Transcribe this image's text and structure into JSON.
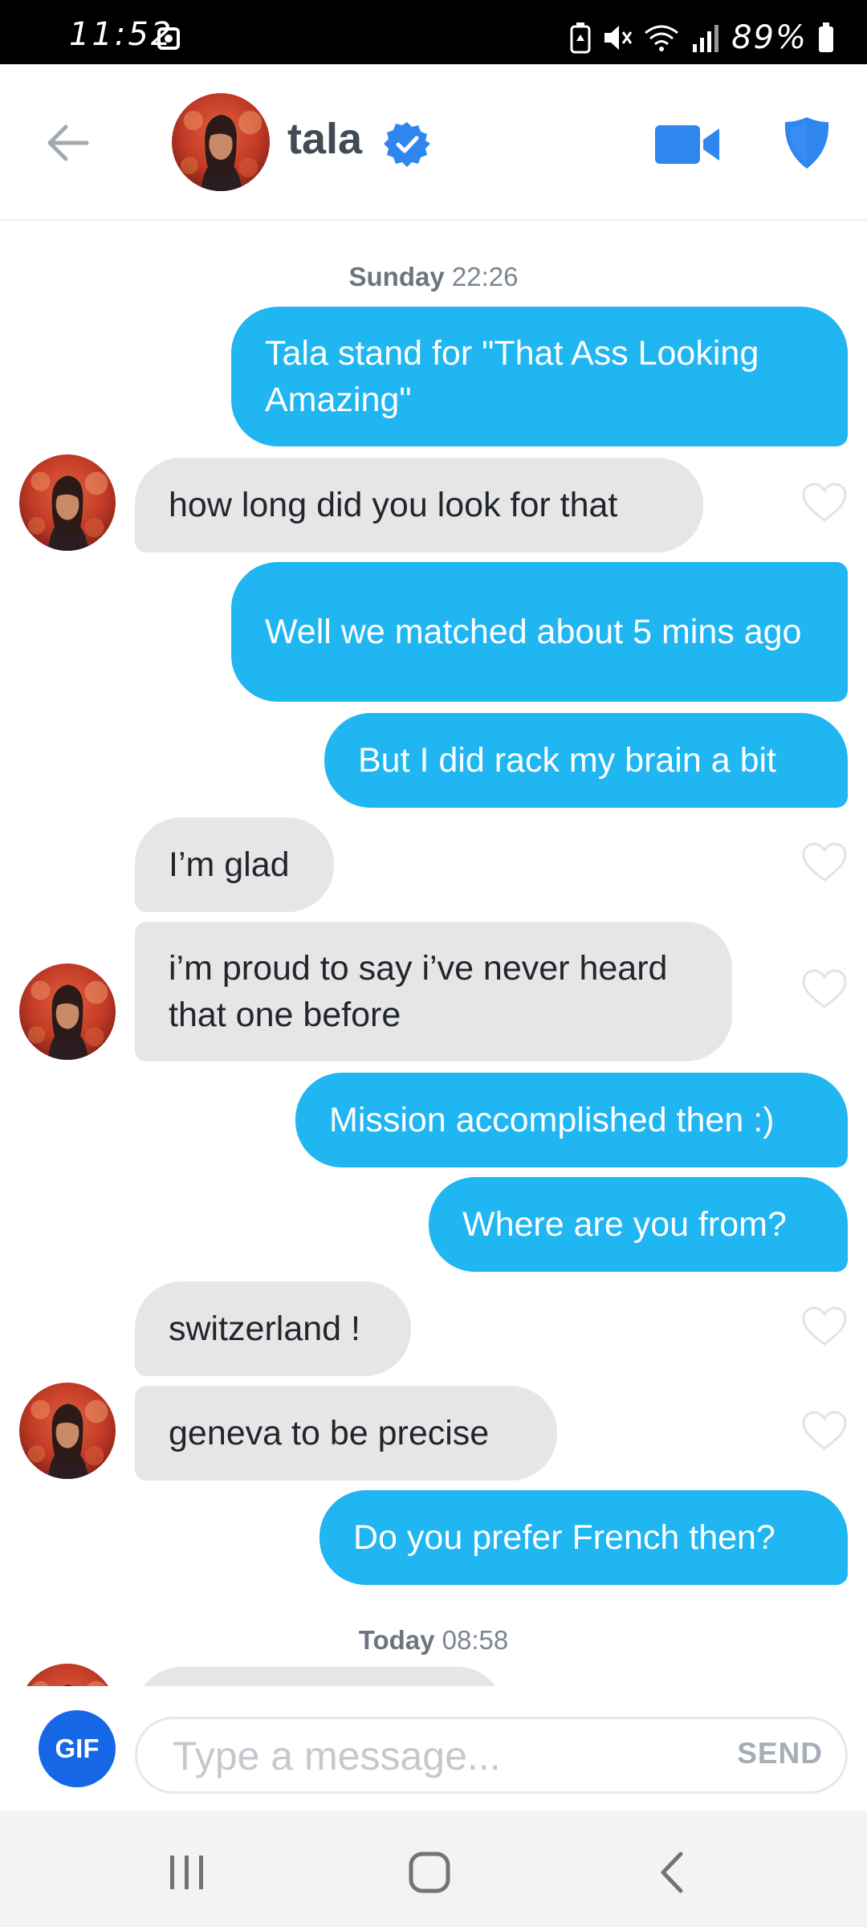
{
  "status_bar": {
    "time": "11:52",
    "battery": "89%"
  },
  "header": {
    "name": "tala"
  },
  "chat": {
    "timestamps": [
      {
        "day": "Sunday",
        "time": "22:26"
      },
      {
        "day": "Today",
        "time": "08:58"
      }
    ],
    "messages": [
      {
        "from": "me",
        "text": "Tala stand for \"That Ass Looking Amazing\""
      },
      {
        "from": "them",
        "text": "how long did you look for that"
      },
      {
        "from": "me",
        "text": "Well we matched about 5 mins ago"
      },
      {
        "from": "me",
        "text": "But I did rack my brain a bit"
      },
      {
        "from": "them",
        "text": "I’m glad"
      },
      {
        "from": "them",
        "text": "i’m proud to say i’ve never heard that one before"
      },
      {
        "from": "me",
        "text": "Mission accomplished then :)"
      },
      {
        "from": "me",
        "text": "Where are you from?"
      },
      {
        "from": "them",
        "text": "switzerland !"
      },
      {
        "from": "them",
        "text": "geneva to be precise"
      },
      {
        "from": "me",
        "text": "Do you prefer French then?"
      }
    ]
  },
  "composer": {
    "gif_label": "GIF",
    "placeholder": "Type a message...",
    "send_label": "SEND"
  },
  "colors": {
    "outgoing": "#1fb6f2",
    "incoming": "#e6e6e6",
    "accent": "#2f86ef",
    "gif": "#1667e6"
  },
  "icons": {
    "back": "arrow-left-icon",
    "verified": "verified-badge-icon",
    "video": "video-camera-icon",
    "safety": "shield-icon",
    "like": "heart-outline-icon",
    "recents": "recents-icon",
    "home": "home-icon",
    "nav_back": "chevron-left-icon"
  }
}
